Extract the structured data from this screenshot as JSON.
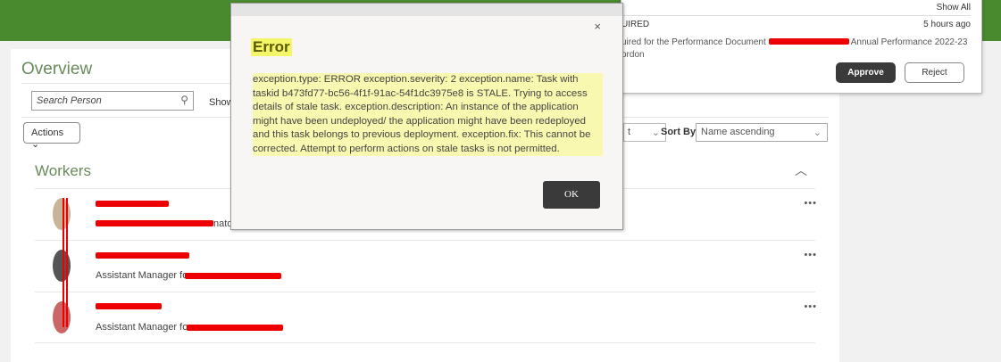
{
  "header": {
    "color": "#4a8a2f"
  },
  "overview": {
    "title": "Overview",
    "search_placeholder": "Search Person",
    "show_label": "Show",
    "actions_label": "Actions",
    "filter_partial": "t",
    "sort_label": "Sort By",
    "sort_value": "Name ascending",
    "workers_title": "Workers",
    "workers": [
      {
        "role": "nato"
      },
      {
        "role": "Assistant Manager for"
      },
      {
        "role": "Assistant Manager for"
      }
    ]
  },
  "notification": {
    "show_all": "Show All",
    "title_partial": "UIRED",
    "time": "5 hours ago",
    "desc_start": "uired for the Performance Document",
    "desc_end": "Annual Performance 2022-23",
    "desc_line2": "ordon",
    "approve": "Approve",
    "reject": "Reject"
  },
  "dialog": {
    "title": "Error",
    "close": "×",
    "message": "exception.type: ERROR exception.severity: 2 exception.name: Task with taskid b473fd77-bc56-4f1f-91ac-54f1dc3975e8 is STALE. Trying to access details of stale task. exception.description: An instance of the application might have been undeployed/ the application might have been redeployed and this task belongs to previous deployment. exception.fix: This cannot be corrected. Attempt to perform actions on stale tasks is not permitted.",
    "ok": "OK"
  }
}
